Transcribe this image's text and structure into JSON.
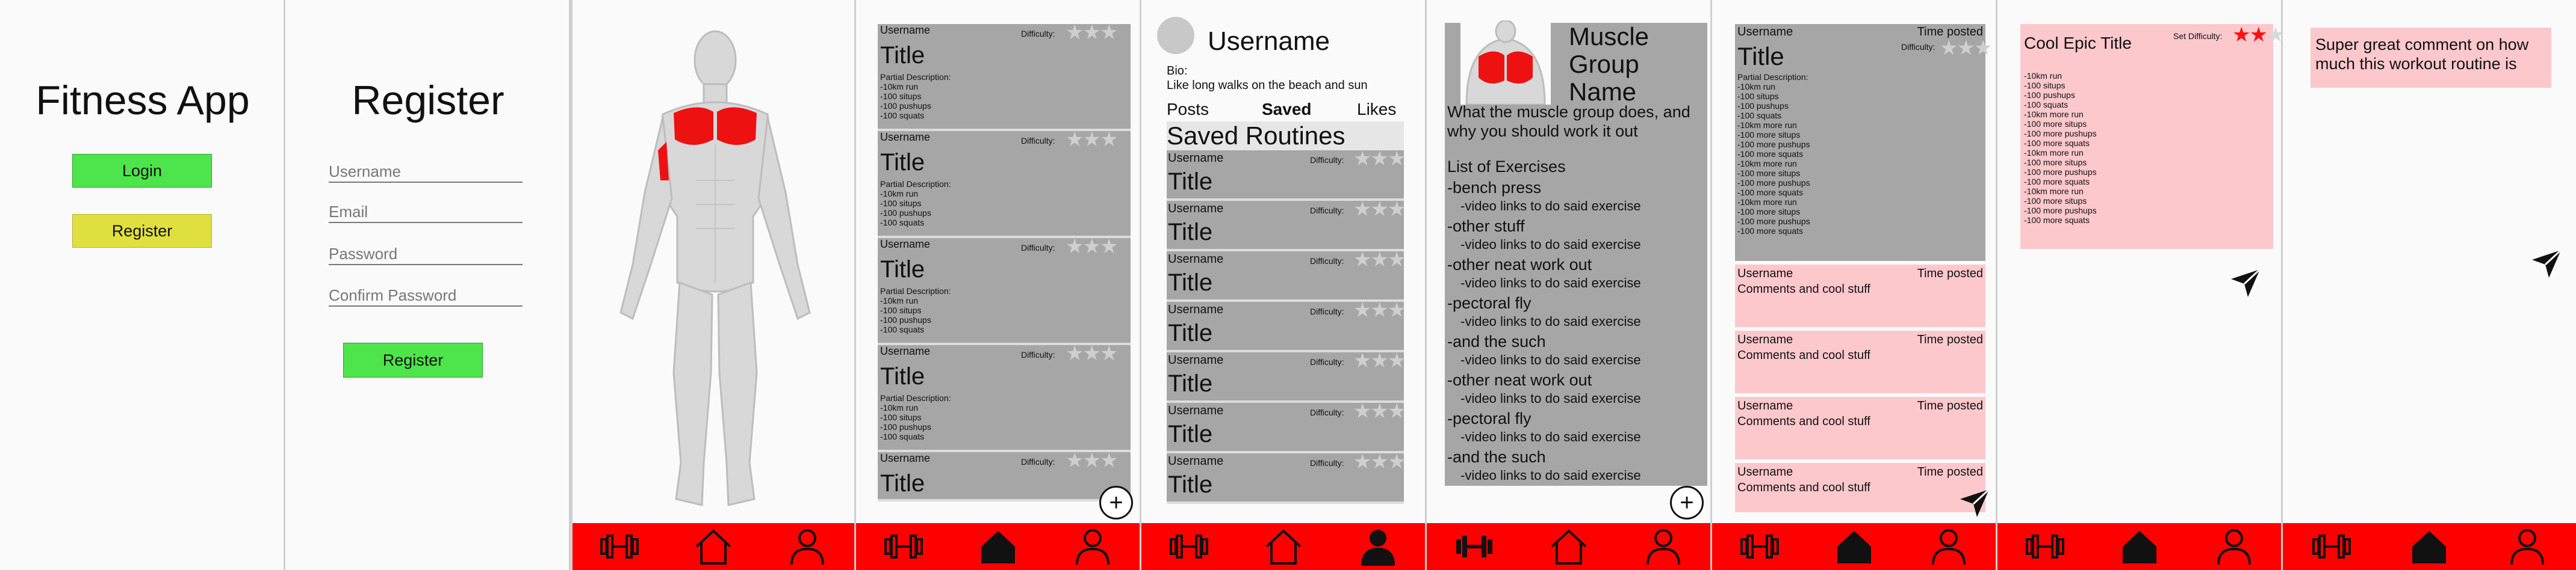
{
  "icons": {
    "nav_left": "dumbbell-icon",
    "nav_center": "home-icon",
    "nav_right": "user-icon",
    "send": "send-icon",
    "add": "plus-circle-icon",
    "star": "star-icon"
  },
  "colors": {
    "nav": "#ff0000",
    "card": "#a6a6a6",
    "pink": "#fcc8cc",
    "login": "#4ee44b",
    "register": "#dfdf3f",
    "muscle": "#ee1111"
  },
  "welcome": {
    "title": "Fitness App",
    "login": "Login",
    "register": "Register"
  },
  "register": {
    "title": "Register",
    "fields": [
      "Username",
      "Email",
      "Password",
      "Confirm Password"
    ],
    "submit": "Register"
  },
  "routines": {
    "items": [
      {
        "user": "Username",
        "difficulty": "Difficulty:",
        "title": "Title",
        "desc_label": "Partial Description:",
        "lines": [
          "-10km run",
          "-100 situps",
          "-100 pushups",
          "-100 squats"
        ]
      },
      {
        "user": "Username",
        "difficulty": "Difficulty:",
        "title": "Title",
        "desc_label": "Partial Description:",
        "lines": [
          "-10km run",
          "-100 situps",
          "-100 pushups",
          "-100 squats"
        ]
      },
      {
        "user": "Username",
        "difficulty": "Difficulty:",
        "title": "Title",
        "desc_label": "Partial Description:",
        "lines": [
          "-10km run",
          "-100 situps",
          "-100 pushups",
          "-100 squats"
        ]
      },
      {
        "user": "Username",
        "difficulty": "Difficulty:",
        "title": "Title",
        "desc_label": "Partial Description:",
        "lines": [
          "-10km run",
          "-100 situps",
          "-100 pushups",
          "-100 squats"
        ]
      },
      {
        "user": "Username",
        "difficulty": "Difficulty:",
        "title": "Title",
        "desc_label": "",
        "lines": []
      }
    ]
  },
  "profile": {
    "username": "Username",
    "bio_label": "Bio:",
    "bio": "Like long walks on the beach and sun",
    "tabs": [
      "Posts",
      "Saved",
      "Likes"
    ],
    "section": "Saved Routines",
    "item_user": "Username",
    "item_difficulty": "Difficulty:",
    "item_title": "Title"
  },
  "muscle": {
    "title": "Muscle Group Name",
    "intro": "What the muscle group does, and why you should work it out",
    "list_label": "List of Exercises",
    "exercises": [
      {
        "name": "-bench press",
        "video": "-video links to do said exercise"
      },
      {
        "name": "-other stuff",
        "video": "-video links to do said exercise"
      },
      {
        "name": "-other neat work out",
        "video": "-video links to do said exercise"
      },
      {
        "name": "-pectoral fly",
        "video": "-video links to do said exercise"
      },
      {
        "name": "-and the such",
        "video": "-video links to do said exercise"
      },
      {
        "name": "-other neat work out",
        "video": "-video links to do said exercise"
      },
      {
        "name": "-pectoral fly",
        "video": "-video links to do said exercise"
      },
      {
        "name": "-and the such",
        "video": "-video links to do said exercise"
      }
    ]
  },
  "detail": {
    "user": "Username",
    "time": "Time posted",
    "difficulty": "Difficulty:",
    "title": "Title",
    "desc_label": "Partial Description:",
    "lines": [
      "-10km run",
      "-100 situps",
      "-100 pushups",
      "-100 squats",
      "-10km more run",
      "-100 more situps",
      "-100 more pushups",
      "-100 more squats",
      "-10km more run",
      "-100 more situps",
      "-100 more pushups",
      "-100 more squats",
      "-10km more run",
      "-100 more situps",
      "-100 more pushups",
      "-100 more squats"
    ],
    "comments": [
      {
        "user": "Username",
        "time": "Time posted",
        "text": "Comments and cool stuff"
      },
      {
        "user": "Username",
        "time": "Time posted",
        "text": "Comments and cool stuff"
      },
      {
        "user": "Username",
        "time": "Time posted",
        "text": "Comments and cool stuff"
      },
      {
        "user": "Username",
        "time": "Time posted",
        "text": "Comments and cool stuff"
      }
    ]
  },
  "create": {
    "title": "Cool Epic Title",
    "difficulty_label": "Set Difficulty:",
    "difficulty_value": 2,
    "difficulty_max": 3,
    "lines": [
      "-10km run",
      "-100 situps",
      "-100 pushups",
      "-100 squats",
      "-10km more run",
      "-100 more situps",
      "-100 more pushups",
      "-100 more squats",
      "-10km more run",
      "-100 more situps",
      "-100 more pushups",
      "-100 more squats",
      "-10km more run",
      "-100 more situps",
      "-100 more pushups",
      "-100 more squats"
    ]
  },
  "comment": {
    "text": "Super great comment on how much this workout routine is"
  }
}
